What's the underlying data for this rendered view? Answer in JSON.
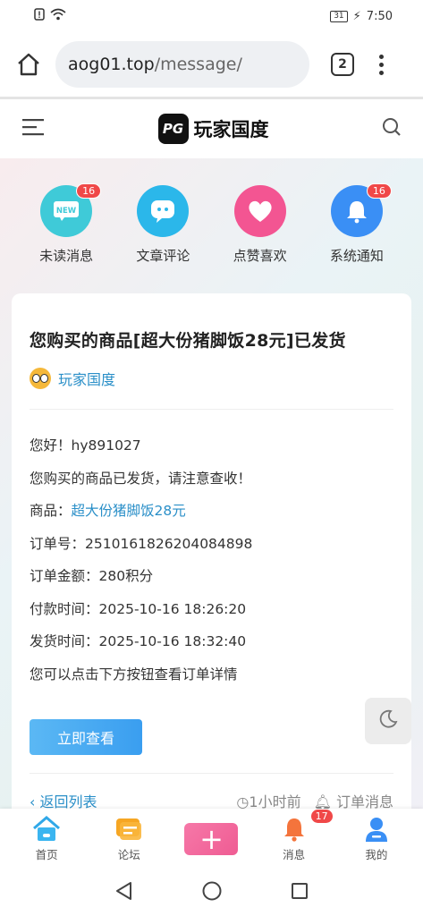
{
  "status": {
    "time": "7:50",
    "battery": "31"
  },
  "browser": {
    "url_host": "aog01.top",
    "url_path": "/message/",
    "tab_count": "2"
  },
  "site": {
    "logo_mark": "PG",
    "name": "玩家国度"
  },
  "quicknav": [
    {
      "label": "未读消息",
      "badge": "16",
      "icon_text": "NEW",
      "color": "#3fcad8"
    },
    {
      "label": "文章评论",
      "badge": "",
      "color": "#2bb7ea"
    },
    {
      "label": "点赞喜欢",
      "badge": "",
      "color": "#f35592"
    },
    {
      "label": "系统通知",
      "badge": "16",
      "color": "#3a8ff5"
    }
  ],
  "message": {
    "title": "您购买的商品[超大份猪脚饭28元]已发货",
    "author": "玩家国度",
    "greeting": "您好！hy891027",
    "line1": "您购买的商品已发货，请注意查收！",
    "product_label": "商品：",
    "product_name": "超大份猪脚饭28元",
    "order_no": "订单号：2510161826204084898",
    "amount": "订单金额：280积分",
    "paid_time": "付款时间：2025-10-16 18:26:20",
    "ship_time": "发货时间：2025-10-16 18:32:40",
    "hint": "您可以点击下方按钮查看订单详情",
    "view_button": "立即查看",
    "back_link": "返回列表",
    "time_ago": "1小时前",
    "category": "订单消息"
  },
  "bottomnav": [
    {
      "label": "首页"
    },
    {
      "label": "论坛"
    },
    {
      "label": ""
    },
    {
      "label": "消息",
      "badge": "17"
    },
    {
      "label": "我的"
    }
  ]
}
